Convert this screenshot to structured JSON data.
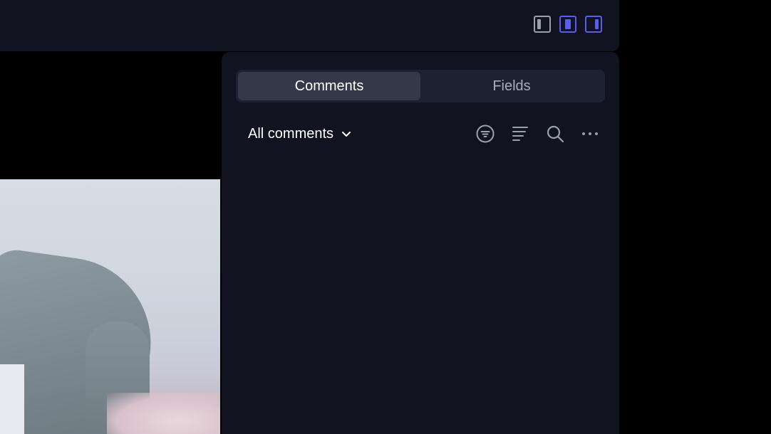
{
  "layout_toggles": [
    {
      "name": "left-panel",
      "active": false
    },
    {
      "name": "center-panel",
      "active": true
    },
    {
      "name": "right-panel",
      "active": true
    }
  ],
  "panel": {
    "tabs": [
      {
        "label": "Comments",
        "active": true
      },
      {
        "label": "Fields",
        "active": false
      }
    ],
    "filter_label": "All comments",
    "tools": [
      "filter-icon",
      "sort-icon",
      "search-icon",
      "more-icon"
    ]
  },
  "colors": {
    "accent": "#5b5cf0",
    "panel_bg": "#121320",
    "tab_active_bg": "#343848",
    "icon": "#9aa0ad"
  }
}
